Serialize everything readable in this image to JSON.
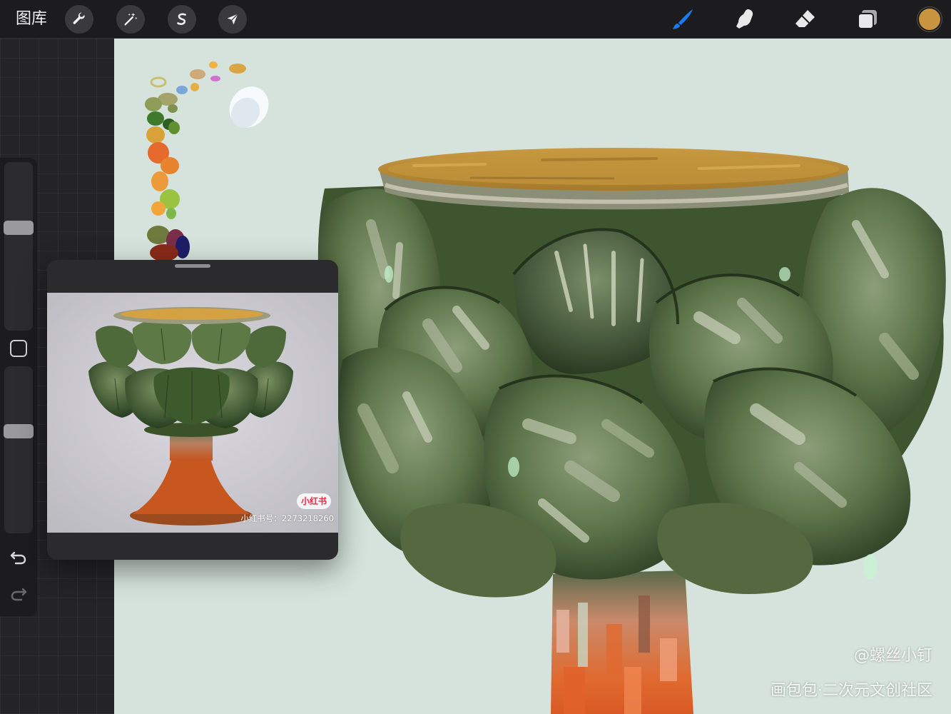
{
  "toolbar": {
    "gallery_label": "图库",
    "left_tools": [
      {
        "name": "actions",
        "icon": "wrench-icon"
      },
      {
        "name": "adjustments",
        "icon": "magic-wand-icon"
      },
      {
        "name": "selection",
        "icon": "selection-s-icon"
      },
      {
        "name": "transform",
        "icon": "arrow-cursor-icon"
      }
    ],
    "right_tools": [
      {
        "name": "brush",
        "icon": "brush-icon",
        "active": true
      },
      {
        "name": "smudge",
        "icon": "smudge-finger-icon",
        "active": false
      },
      {
        "name": "eraser",
        "icon": "eraser-icon",
        "active": false
      },
      {
        "name": "layers",
        "icon": "layers-icon",
        "active": false
      }
    ],
    "current_color": "#c99440",
    "active_tool_color": "#1a7cf5"
  },
  "sidebar": {
    "brush_size_level": 0.62,
    "opacity_level": 0.62,
    "modify_button_icon": "square-modify-icon",
    "undo_icon": "undo-icon",
    "redo_icon": "redo-icon"
  },
  "reference": {
    "badge": "小红书",
    "id_text": "小红书号：2273218260"
  },
  "watermarks": {
    "author": "@螺丝小钉",
    "community": "画包包·二次元文创社区"
  },
  "colors": {
    "canvas_background": "#d5e3dc",
    "chrome": "#1c1c1e",
    "rim_ochre": "#b98a34",
    "leaf_green": "#5d7449",
    "stem_orange": "#e06a30"
  }
}
